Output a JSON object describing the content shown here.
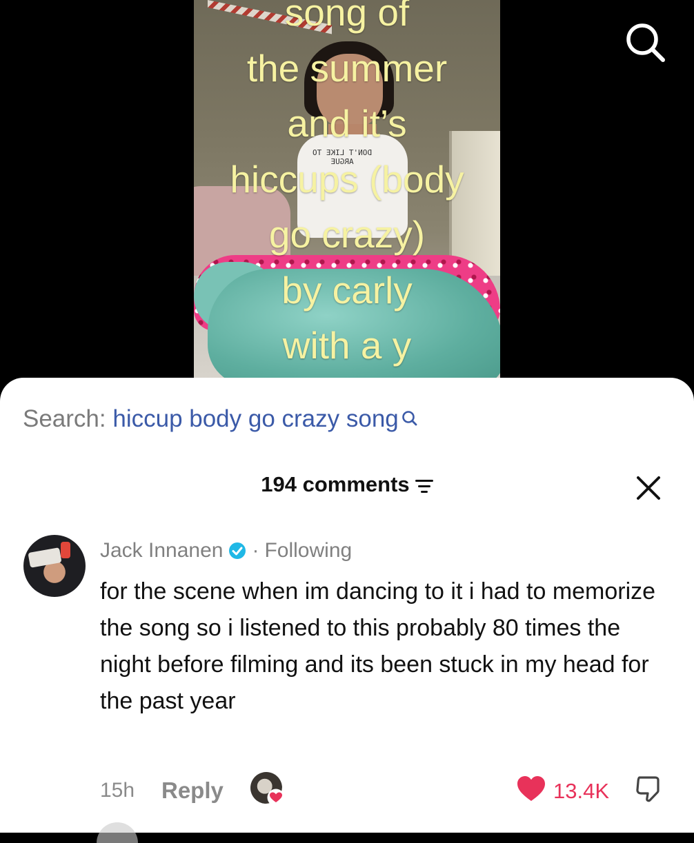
{
  "video": {
    "caption_lines": [
      "song of",
      "the summer",
      "and it’s",
      "hiccups (body",
      "go crazy)",
      "by carly",
      "with a y"
    ],
    "shirt_print": "DON'T LIKE TO ARGUE",
    "overlay_text_color": "#f6f2a2"
  },
  "top_bar": {
    "search_icon": "search-icon"
  },
  "search_suggestion": {
    "label": "Search:",
    "query": "hiccup body go crazy song",
    "query_color": "#3b5aa8",
    "icon": "search-icon"
  },
  "comments_header": {
    "count_label": "194 comments",
    "filter_icon": "filter-icon",
    "close_icon": "close-icon"
  },
  "comment": {
    "author": "Jack Innanen",
    "verified": true,
    "separator": "·",
    "relationship": "Following",
    "text": "for the scene when im dancing to it i had to memorize the song so i listened to this probably 80 times the night before filming and its been stuck in my head for the past year",
    "timestamp": "15h",
    "reply_label": "Reply",
    "creator_liked": true,
    "likes": "13.4K",
    "like_color": "#e8325a",
    "dislike_icon": "thumbs-down-icon"
  }
}
